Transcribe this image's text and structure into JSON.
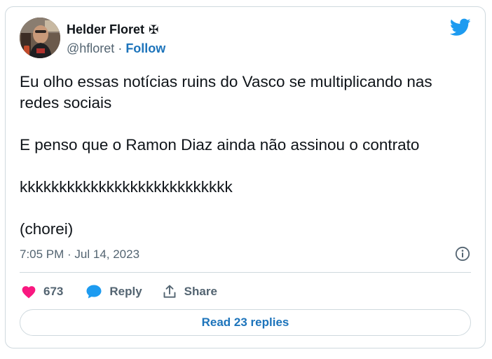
{
  "author": {
    "display_name": "Helder Floret",
    "name_symbol": "✠",
    "handle": "@hfloret",
    "separator": "·",
    "follow_label": "Follow"
  },
  "tweet": {
    "lines": [
      "Eu olho essas notícias ruins do Vasco se multiplicando nas redes sociais",
      "E penso que o Ramon Diaz ainda não assinou o contrato",
      "kkkkkkkkkkkkkkkkkkkkkkkkkkk",
      "(chorei)"
    ],
    "timestamp": "7:05 PM · Jul 14, 2023"
  },
  "actions": {
    "like_count": "673",
    "reply_label": "Reply",
    "share_label": "Share"
  },
  "read_replies_label": "Read 23 replies",
  "colors": {
    "accent": "#1d9bf0",
    "link": "#1d74bb",
    "like": "#f91880",
    "muted": "#536471",
    "border": "#cfd9de"
  },
  "icons": {
    "logo": "twitter-bird-icon",
    "info": "info-icon",
    "like": "heart-icon",
    "reply": "speech-bubble-icon",
    "share": "share-upload-icon"
  }
}
